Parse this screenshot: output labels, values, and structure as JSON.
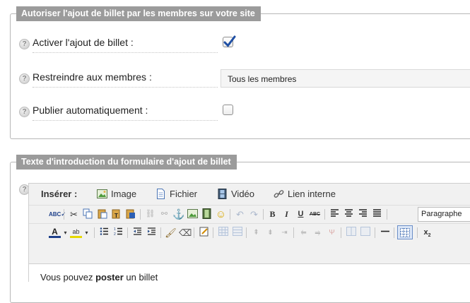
{
  "section1": {
    "legend": "Autoriser l'ajout de billet par les membres sur votre site",
    "rows": [
      {
        "label": "Activer l'ajout de billet :",
        "checked": true
      },
      {
        "label": "Restreindre aux membres :",
        "value": "Tous les membres"
      },
      {
        "label": "Publier automatiquement :",
        "checked": false
      }
    ]
  },
  "section2": {
    "legend": "Texte d'introduction du formulaire d'ajout de billet",
    "insert_label": "Insérer :",
    "insert_items": [
      "Image",
      "Fichier",
      "Vidéo",
      "Lien interne"
    ],
    "format_select": "Paragraphe",
    "content": {
      "before": "Vous pouvez ",
      "bold": "poster",
      "after": " un billet"
    }
  },
  "help_icon": "?",
  "toolbar_icons_row1": [
    "spellcheck-icon",
    "cut-icon",
    "copy-icon",
    "paste-icon",
    "paste-text-icon",
    "paste-word-icon",
    "link-icon",
    "unlink-icon",
    "anchor-icon",
    "image-icon",
    "media-icon",
    "emoticon-icon",
    "undo-icon",
    "redo-icon",
    "bold-icon",
    "italic-icon",
    "underline-icon",
    "strikethrough-icon",
    "align-left-icon",
    "align-center-icon",
    "align-right-icon",
    "align-justify-icon"
  ],
  "toolbar_icons_row2": [
    "text-color-icon",
    "highlight-color-icon",
    "bullet-list-icon",
    "numbered-list-icon",
    "outdent-icon",
    "indent-icon",
    "cleanup-icon",
    "eraser-icon",
    "edit-source-icon",
    "table-icons",
    "horizontal-rule-icon",
    "visual-aid-icon",
    "subscript-icon"
  ],
  "colors": {
    "legend_bg": "#9b9b9b",
    "checkbox_check": "#1f4fa3"
  }
}
